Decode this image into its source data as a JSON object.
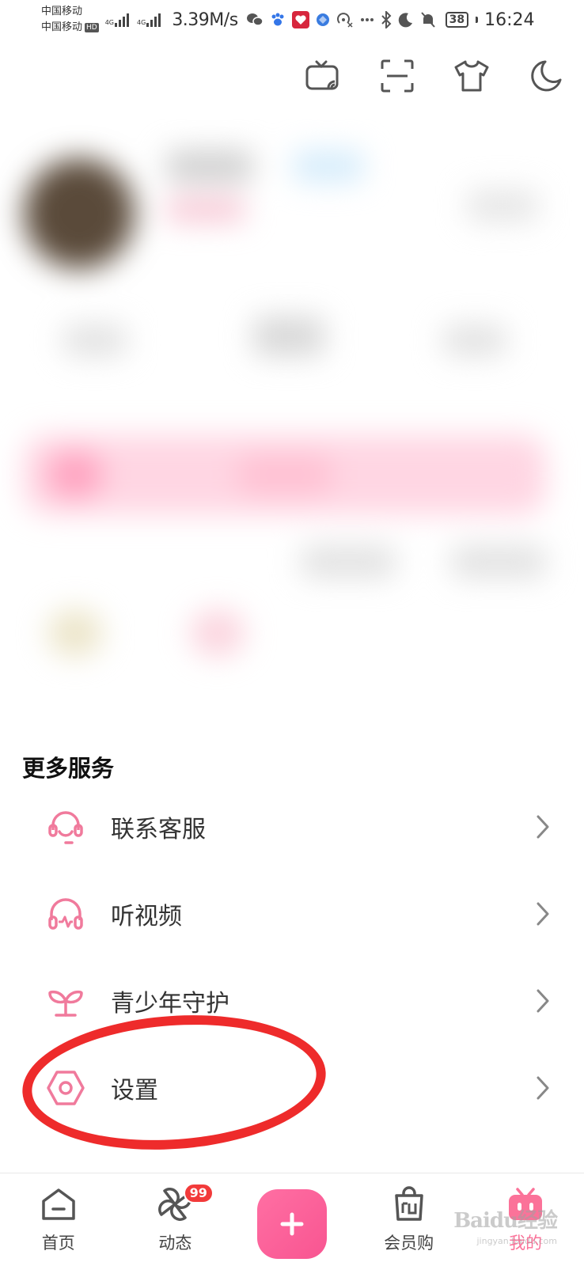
{
  "status_bar": {
    "carrier_1": "中国移动",
    "carrier_2": "中国移动",
    "hd_badge": "HD",
    "network_1": "4G",
    "network_2": "4G",
    "speed": "3.39M/s",
    "battery": "38",
    "time": "16:24"
  },
  "top_actions": [
    {
      "icon": "tv-cast-icon"
    },
    {
      "icon": "scan-icon"
    },
    {
      "icon": "theme-shirt-icon"
    },
    {
      "icon": "night-mode-icon"
    }
  ],
  "more_services": {
    "title": "更多服务",
    "items": [
      {
        "label": "联系客服",
        "icon": "customer-service-icon"
      },
      {
        "label": "听视频",
        "icon": "listen-video-icon"
      },
      {
        "label": "青少年守护",
        "icon": "youth-protection-icon"
      },
      {
        "label": "设置",
        "icon": "settings-icon"
      }
    ]
  },
  "bottom_nav": {
    "items": [
      {
        "label": "首页",
        "icon": "home-icon"
      },
      {
        "label": "动态",
        "icon": "pinwheel-icon",
        "badge": "99"
      },
      {
        "label": "",
        "icon": "plus-icon"
      },
      {
        "label": "会员购",
        "icon": "shopping-bag-icon"
      },
      {
        "label": "我的",
        "icon": "tv-mascot-icon",
        "active": true
      }
    ]
  },
  "watermark": {
    "text": "Baidu经验",
    "sub": "jingyan.baidu.com"
  },
  "colors": {
    "accent": "#fb7299",
    "annotation": "#ee2b2b"
  }
}
